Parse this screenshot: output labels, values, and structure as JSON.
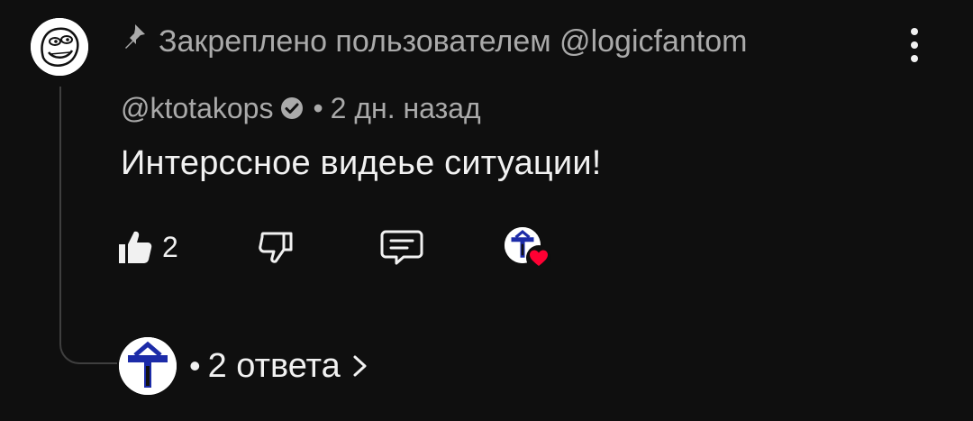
{
  "pinned": {
    "text": "Закреплено пользователем @logicfantom",
    "icon": "pin-icon"
  },
  "comment": {
    "author": "@ktotakops",
    "verified_icon": "verified-check-icon",
    "separator": "•",
    "timestamp": "2 дн. назад",
    "text": "Интерссное видеье ситуации!"
  },
  "actions": {
    "like_icon": "thumb-up-icon",
    "like_count": "2",
    "dislike_icon": "thumb-down-icon",
    "reply_icon": "reply-comment-icon",
    "creator_heart_icon": "creator-heart-icon"
  },
  "replies": {
    "separator": "•",
    "label": "2 ответа",
    "chevron_icon": "chevron-right-icon"
  },
  "menu": {
    "icon": "more-vert-icon"
  },
  "colors": {
    "background": "#0f0f0f",
    "primary_text": "#f1f1f1",
    "secondary_text": "#aaaaaa",
    "heart": "#ff0033",
    "avatar_accent": "#1c2ba8"
  }
}
